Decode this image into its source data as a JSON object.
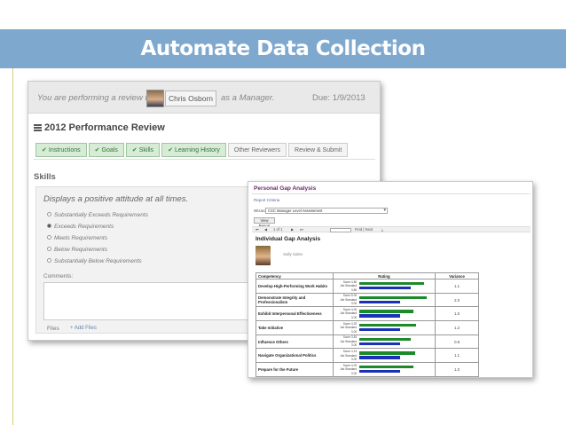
{
  "slide": {
    "title": "Automate Data Collection"
  },
  "review": {
    "reviewing_text": "You are performing a review for",
    "reviewee_name": "Chris Osborn",
    "role_text": "as a Manager.",
    "due_text": "Due: 1/9/2013",
    "heading": "2012 Performance Review",
    "tabs": [
      {
        "label": "Instructions",
        "completed": true
      },
      {
        "label": "Goals",
        "completed": true
      },
      {
        "label": "Skills",
        "completed": true
      },
      {
        "label": "Learning History",
        "completed": true
      },
      {
        "label": "Other Reviewers",
        "completed": false
      },
      {
        "label": "Review & Submit",
        "completed": false
      }
    ],
    "section_label": "Skills",
    "question": "Displays a positive attitude at all times.",
    "options": [
      {
        "label": "Substantially Exceeds Requirements",
        "selected": false
      },
      {
        "label": "Exceeds Requirements",
        "selected": true
      },
      {
        "label": "Meets Requirements",
        "selected": false
      },
      {
        "label": "Below Requirements",
        "selected": false
      },
      {
        "label": "Substantially Below Requirements",
        "selected": false
      }
    ],
    "comments_label": "Comments:",
    "files_label": "Files",
    "add_files_label": "+ Add Files"
  },
  "gap": {
    "window_title": "Personal Gap Analysis",
    "criteria_link": "Report Criteria",
    "filter_label": "Wizard",
    "filter_value": "CSC Manager Level Assessment",
    "view_button": "View Report",
    "toolbar": {
      "first": "⏮",
      "prev": "◀",
      "page_text": "1 of 1",
      "next": "▶",
      "last": "⏭",
      "find": "Find | Next",
      "export_icon": "export-icon"
    },
    "report_title": "Individual Gap Analysis",
    "person_name": "Sally Sales",
    "columns": {
      "competency": "Competency",
      "rating": "Rating",
      "variance": "Variance"
    },
    "score_label": "Score",
    "job_standard_label": "Job Standard",
    "rows": [
      {
        "competency": "Develop High-Performing Work Habits",
        "score": 4.8,
        "job_standard": 3.8,
        "variance": "1.1",
        "score_text": "4.80",
        "std_text": "3.80"
      },
      {
        "competency": "Demonstrate Integrity and Professionalism",
        "score": 5.0,
        "job_standard": 3.0,
        "variance": "2.0",
        "score_text": "5.00",
        "std_text": "3.00"
      },
      {
        "competency": "Exhibit Interpersonal Effectiveness",
        "score": 4.0,
        "job_standard": 3.0,
        "variance": "1.0",
        "score_text": "4.00",
        "std_text": "3.00"
      },
      {
        "competency": "Take Initiative",
        "score": 4.2,
        "job_standard": 3.0,
        "variance": "1.2",
        "score_text": "4.20",
        "std_text": "3.00"
      },
      {
        "competency": "Influence Others",
        "score": 3.83,
        "job_standard": 3.0,
        "variance": "0.8",
        "score_text": "3.83",
        "std_text": "3.00"
      },
      {
        "competency": "Navigate Organizational Politics",
        "score": 4.14,
        "job_standard": 3.0,
        "variance": "1.1",
        "score_text": "4.14",
        "std_text": "3.00"
      },
      {
        "competency": "Prepare for the Future",
        "score": 4.0,
        "job_standard": 3.0,
        "variance": "1.0",
        "score_text": "4.00",
        "std_text": "3.00"
      }
    ],
    "rating_max": 5
  },
  "colors": {
    "title_bar": "#7fa8cf",
    "score_bar": "#1d8a2a",
    "standard_bar": "#1c2fb8",
    "tab_completed": "#d6ecd6"
  }
}
